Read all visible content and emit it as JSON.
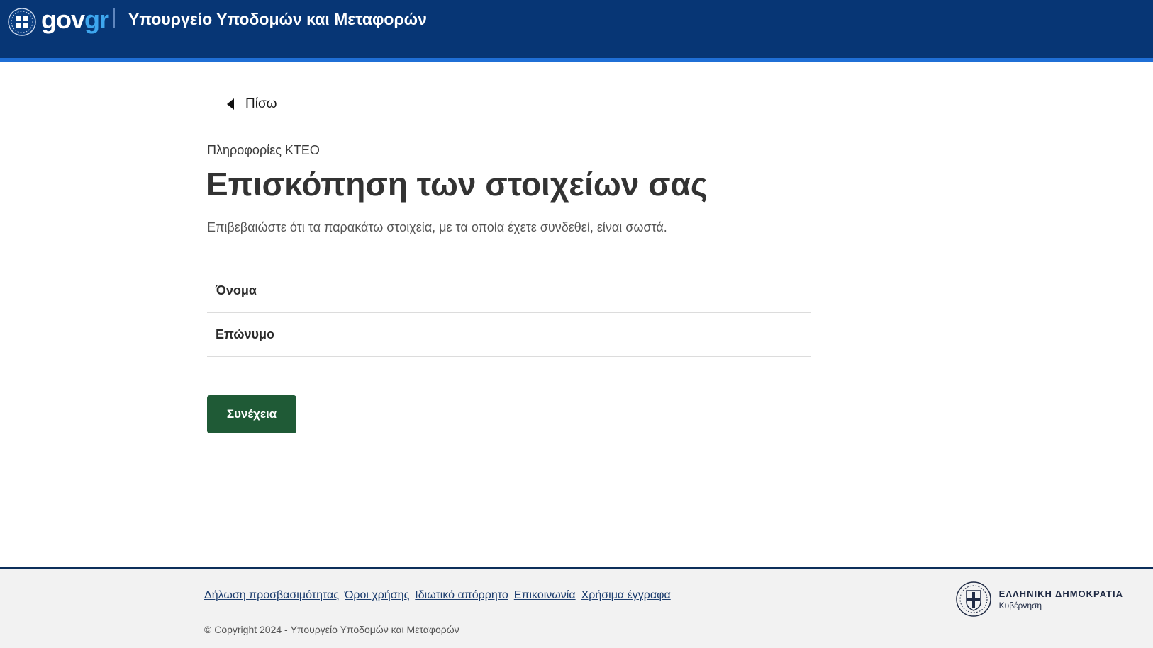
{
  "header": {
    "brand_gov": "gov",
    "brand_gr": "gr",
    "ministry": "Υπουργείο Υποδομών και Μεταφορών",
    "colors": {
      "background": "#073675",
      "accent_bar": "#1f6fd6",
      "brand_gr": "#3ea7ee"
    }
  },
  "nav": {
    "back_label": "Πίσω"
  },
  "main": {
    "caption": "Πληροφορίες ΚΤΕΟ",
    "title": "Επισκόπηση των στοιχείων σας",
    "lead": "Επιβεβαιώστε ότι τα παρακάτω στοιχεία, με τα οποία έχετε συνδεθεί, είναι σωστά.",
    "rows": [
      {
        "key": "Όνομα",
        "value": ""
      },
      {
        "key": "Επώνυμο",
        "value": ""
      }
    ],
    "continue_label": "Συνέχεια",
    "continue_color": "#1f5a36"
  },
  "footer": {
    "links": [
      "Δήλωση προσβασιμότητας",
      "Όροι χρήσης",
      "Ιδιωτικό απόρρητο",
      "Επικοινωνία",
      "Χρήσιμα έγγραφα"
    ],
    "copyright": "© Copyright 2024 - Υπουργείο Υποδομών και Μεταφορών",
    "republic_name": "ΕΛΛΗΝΙΚΗ ΔΗΜΟΚΡΑΤΙΑ",
    "republic_sub": "Κυβέρνηση"
  }
}
